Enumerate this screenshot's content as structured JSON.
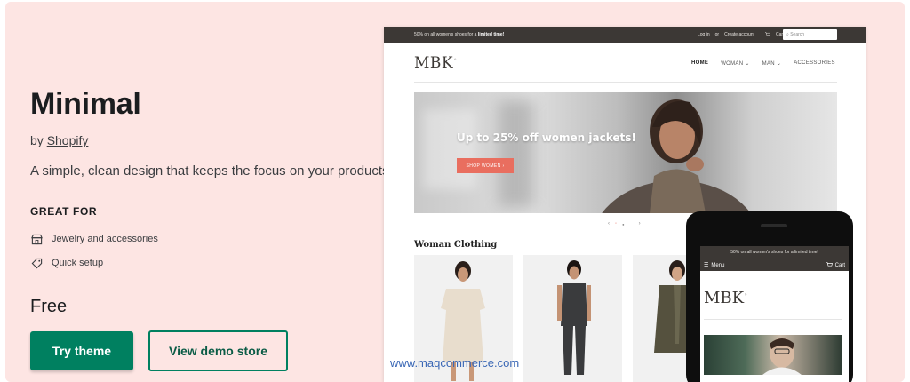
{
  "theme": {
    "name": "Minimal",
    "by_prefix": "by",
    "author": "Shopify",
    "tagline": "A simple, clean design that keeps the focus on your products",
    "great_for_heading": "GREAT FOR",
    "features": [
      {
        "label": "Jewelry and accessories",
        "icon": "storefront-icon"
      },
      {
        "label": "Quick setup",
        "icon": "tag-icon"
      }
    ],
    "price": "Free",
    "try_button": "Try theme",
    "demo_button": "View demo store"
  },
  "preview": {
    "announcement_prefix": "50% on all women's shoes for a ",
    "announcement_bold": "limited time!",
    "login": "Log in",
    "or": "or",
    "create_account": "Create account",
    "cart": "Cart",
    "search_placeholder": "Search",
    "logo": "MBK",
    "nav": [
      "HOME",
      "WOMAN ⌄",
      "MAN ⌄",
      "ACCESSORIES"
    ],
    "hero_title": "Up to 25% off women jackets!",
    "hero_button": "SHOP WOMEN ›",
    "section_title": "Woman Clothing"
  },
  "phone": {
    "announcement": "50% on all women's shoes for a limited time!",
    "menu": "Menu",
    "cart": "Cart",
    "logo": "MBK"
  },
  "colors": {
    "card_bg": "#fde5e3",
    "primary_green": "#008060",
    "store_dark": "#3c3835",
    "hero_button": "#e96e5f"
  },
  "watermark": "www.maqcommerce.com"
}
